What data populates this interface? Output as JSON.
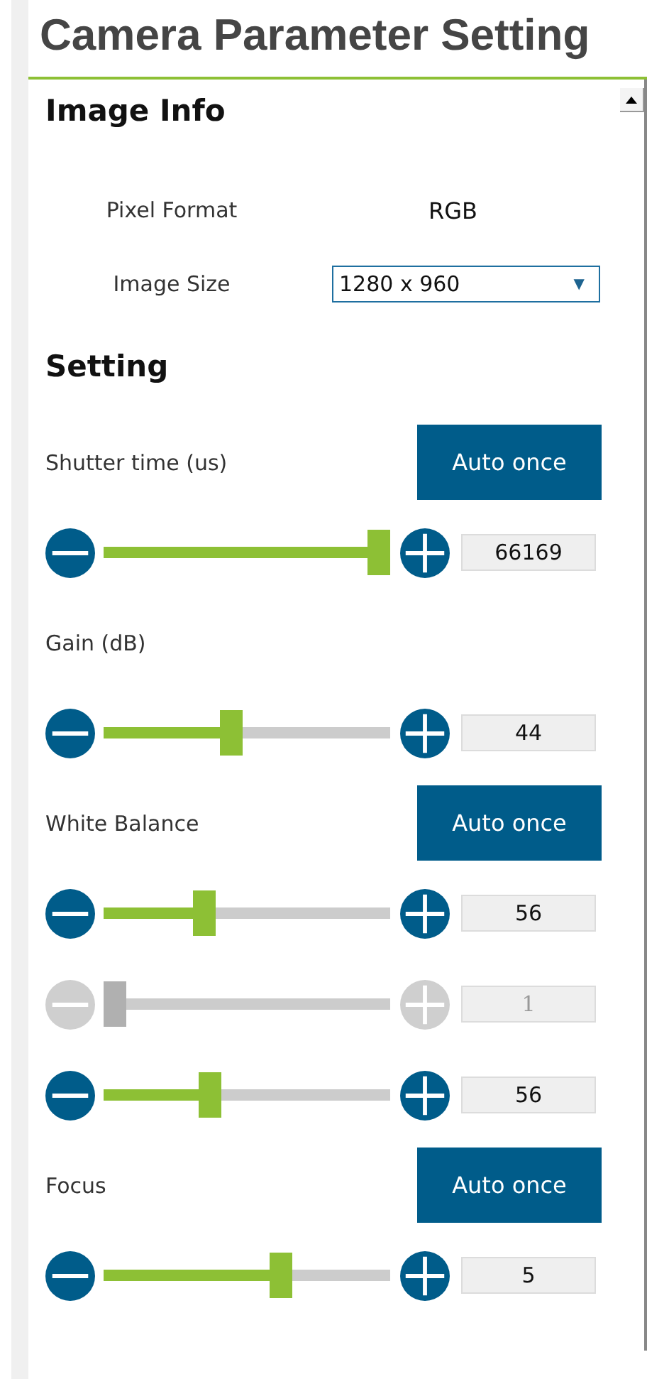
{
  "title": "Camera Parameter Setting",
  "image_info": {
    "heading": "Image Info",
    "fields": [
      {
        "kind": "text",
        "label": "Pixel Format",
        "value": "RGB"
      },
      {
        "kind": "dropdown",
        "label": "Image Size",
        "value": "1280 x 960",
        "caret": "▼"
      }
    ]
  },
  "setting": {
    "heading": "Setting",
    "rows": [
      {
        "kind": "header",
        "label": "Shutter time (us)",
        "button": "Auto once"
      },
      {
        "kind": "slider",
        "level": 1,
        "value": "66169",
        "disabled": false
      },
      {
        "kind": "header",
        "label": "Gain (dB)"
      },
      {
        "kind": "slider",
        "level": 0.44,
        "value": "44",
        "disabled": false
      },
      {
        "kind": "header",
        "label": "White Balance",
        "button": "Auto once"
      },
      {
        "kind": "slider",
        "level": 0.34,
        "value": "56",
        "disabled": false
      },
      {
        "kind": "slider",
        "level": 0,
        "value": "1",
        "disabled": true
      },
      {
        "kind": "slider",
        "level": 0.36,
        "value": "56",
        "disabled": false
      },
      {
        "kind": "header",
        "label": "Focus",
        "button": "Auto once"
      },
      {
        "kind": "slider",
        "level": 0.63,
        "value": "5",
        "disabled": false
      }
    ]
  }
}
